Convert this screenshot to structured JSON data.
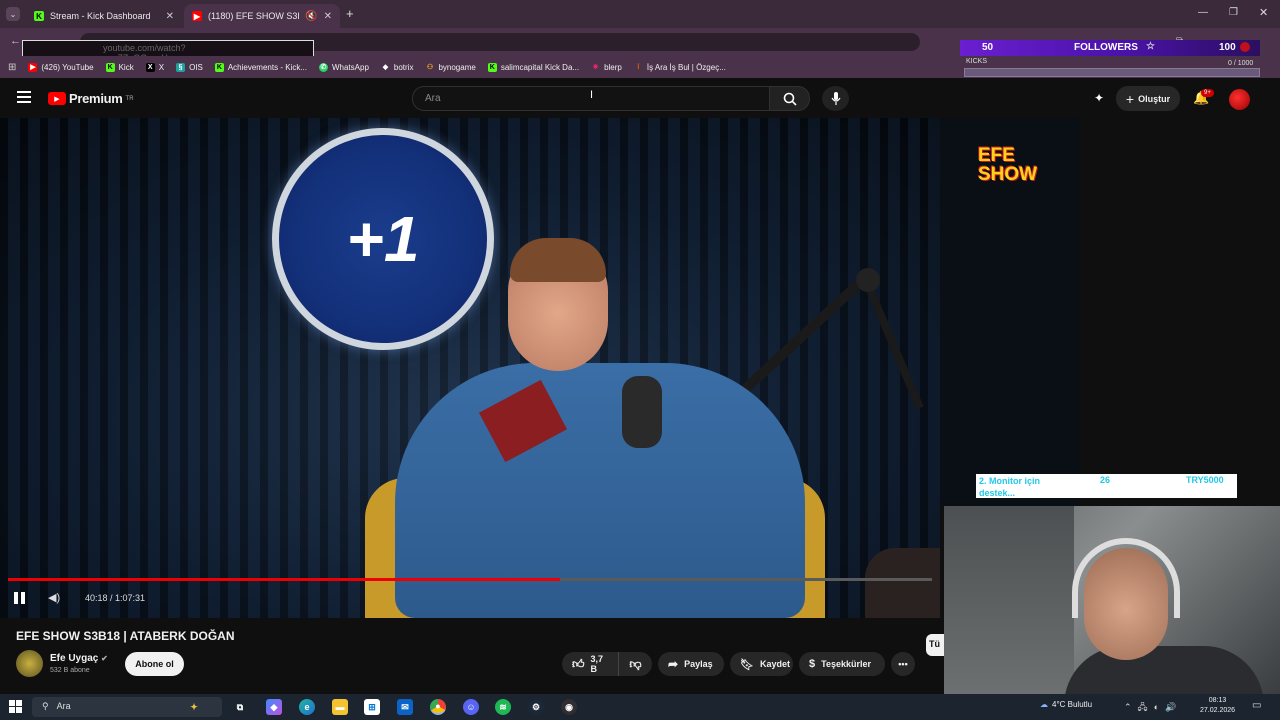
{
  "browser": {
    "tabs": [
      {
        "title": "Stream - Kick Dashboard",
        "active": false
      },
      {
        "title": "(1180) EFE SHOW S3B18 | A",
        "active": true
      }
    ],
    "new_tab": "+",
    "url": "youtube.com/watch?v=u7ZqQCpvgU",
    "bookmarks": [
      {
        "label": "(426) YouTube",
        "color": "#ff0000",
        "glyph": "▶"
      },
      {
        "label": "Kick",
        "color": "#53fc18",
        "glyph": "K"
      },
      {
        "label": "X",
        "color": "#000000",
        "glyph": "X"
      },
      {
        "label": "OIS",
        "color": "#1ea0a0",
        "glyph": "§"
      },
      {
        "label": "Achievements - Kick...",
        "color": "#53fc18",
        "glyph": "K"
      },
      {
        "label": "WhatsApp",
        "color": "#25d366",
        "glyph": "✆"
      },
      {
        "label": "botrix",
        "color": "#ffffff",
        "glyph": "◆"
      },
      {
        "label": "bynogame",
        "color": "#f5a623",
        "glyph": "⚇"
      },
      {
        "label": "salimcapital Kick Da...",
        "color": "#53fc18",
        "glyph": "K"
      },
      {
        "label": "blerp",
        "color": "#e0246d",
        "glyph": "✸"
      },
      {
        "label": "İş Ara İş Bul | Özgeç...",
        "color": "#e85a00",
        "glyph": "ǐ"
      }
    ]
  },
  "overlay": {
    "followers_count": "50",
    "followers_label": "FOLLOWERS",
    "followers_goal": "100",
    "kicks_label": "KICKS",
    "kicks_progress": "0 / 1000",
    "donation": {
      "text": "2. Monitor için destek...",
      "count": "26",
      "amount": "TRY5000"
    }
  },
  "youtube": {
    "logo_text": "Premium",
    "logo_sup": "TR",
    "search_placeholder": "Ara",
    "create_label": "Oluştur",
    "notif_badge": "9+",
    "video": {
      "channel_watermark": "EFE\nSHOW",
      "badge_text": "+1",
      "time": "40:18 / 1:07:31",
      "progress_fraction": 0.597
    },
    "title": "EFE SHOW S3B18 | ATABERK DOĞAN",
    "channel_name": "Efe Uygaç",
    "subscribers": "532 B abone",
    "subscribe_label": "Abone ol",
    "likes": "3,7 B",
    "share_label": "Paylaş",
    "save_label": "Kaydet",
    "thanks_label": "Teşekkürler",
    "side_chip": "Tü"
  },
  "taskbar": {
    "search_placeholder": "Ara",
    "weather": "4°C Bulutlu",
    "time": "08:13",
    "date": "27.02.2026"
  }
}
